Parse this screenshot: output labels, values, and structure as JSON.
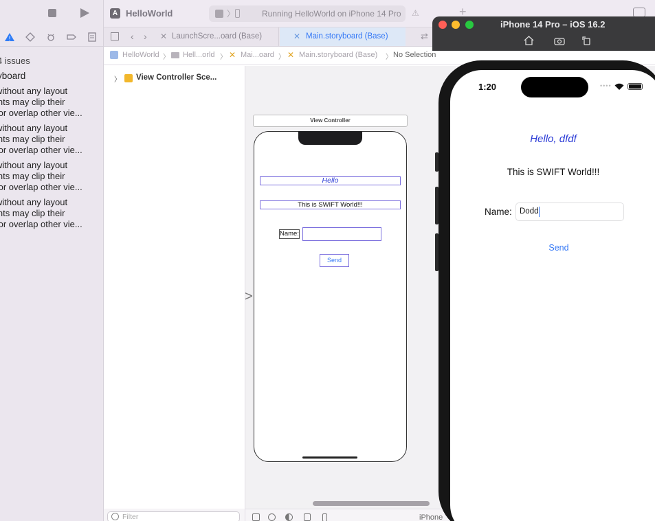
{
  "toolbar": {
    "scheme": "HelloWorld",
    "status": "Running HelloWorld on iPhone 14 Pro"
  },
  "tabs": [
    {
      "label": "LaunchScre...oard (Base)",
      "active": false
    },
    {
      "label": "Main.storyboard (Base)",
      "active": true
    }
  ],
  "jumpbar": [
    "HelloWorld",
    "Hell...orld",
    "Mai...oard",
    "Main.storyboard (Base)",
    "No Selection"
  ],
  "issues": {
    "count_label": "4 issues",
    "group_label": "yboard",
    "items": [
      "without any layout\nints may clip their\n or overlap other vie...",
      "without any layout\nints may clip their\n or overlap other vie...",
      "without any layout\nints may clip their\n or overlap other vie...",
      "without any layout\nints may clip their\n or overlap other vie..."
    ],
    "filter_placeholder": "Filter"
  },
  "outline": {
    "scene_label": "View Controller Sce..."
  },
  "storyboard": {
    "vc_title": "View Controller",
    "hello_label": "Hello",
    "world_label": "This is SWIFT World!!!",
    "name_label": "Name:",
    "send_button": "Send"
  },
  "canvas_bottom": {
    "device_label": "iPhone"
  },
  "simulator": {
    "title": "iPhone 14 Pro – iOS 16.2",
    "time": "1:20",
    "hello_text": "Hello, dfdf",
    "world_text": "This is SWIFT World!!!",
    "name_label": "Name:",
    "name_value": "Dodd",
    "send_button": "Send"
  },
  "colors": {
    "accent": "#3478f6",
    "hello_text": "#2a3ad6",
    "warning": "#e0a11b",
    "traffic_red": "#ff5f57",
    "traffic_yellow": "#febc2e",
    "traffic_green": "#28c840"
  }
}
